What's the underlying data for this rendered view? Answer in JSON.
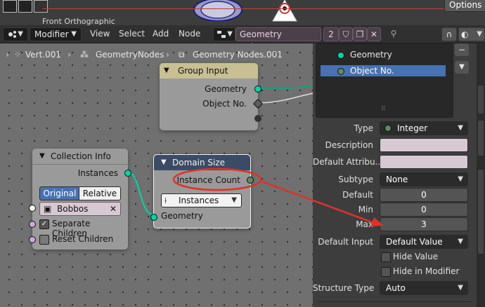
{
  "top": {
    "options_label": "Options",
    "view_label": "Front Orthographic"
  },
  "header": {
    "editor_mode": "Modifier",
    "menus": [
      "View",
      "Select",
      "Add",
      "Node"
    ],
    "node_tree_name": "Geometry Nodes.001",
    "user_count": "2"
  },
  "breadcrumb": {
    "object": "Vert.001",
    "modifier": "GeometryNodes",
    "tree": "Geometry Nodes.001"
  },
  "nodes": {
    "group_input": {
      "title": "Group Input",
      "outputs": [
        "Geometry",
        "Object No."
      ]
    },
    "collection_info": {
      "title": "Collection Info",
      "output": "Instances",
      "transform_options": [
        "Original",
        "Relative"
      ],
      "selected_transform": "Original",
      "collection": "Bobbos",
      "separate_children": "Separate Children",
      "separate_checked": true,
      "reset_children": "Reset Children",
      "reset_checked": false
    },
    "domain_size": {
      "title": "Domain Size",
      "output": "Instance Count",
      "component": "Instances",
      "input": "Geometry"
    }
  },
  "panel": {
    "sockets": [
      "Geometry",
      "Object No."
    ],
    "selected_socket": "Object No.",
    "type_label": "Type",
    "type_value": "Integer",
    "description_label": "Description",
    "description_value": "",
    "default_attr_label": "Default Attribu...",
    "default_attr_value": "",
    "subtype_label": "Subtype",
    "subtype_value": "None",
    "default_label": "Default",
    "default_value": "0",
    "min_label": "Min",
    "min_value": "0",
    "max_label": "Max",
    "max_value": "3",
    "default_input_label": "Default Input",
    "default_input_value": "Default Value",
    "hide_value_label": "Hide Value",
    "hide_modifier_label": "Hide in Modifier",
    "structure_label": "Structure Type",
    "structure_value": "Auto"
  },
  "colors": {
    "annotation": "#e0302b",
    "geometry_socket": "#00d6a3",
    "selection": "#4772b3",
    "group_input_header": "#c8bf92"
  }
}
